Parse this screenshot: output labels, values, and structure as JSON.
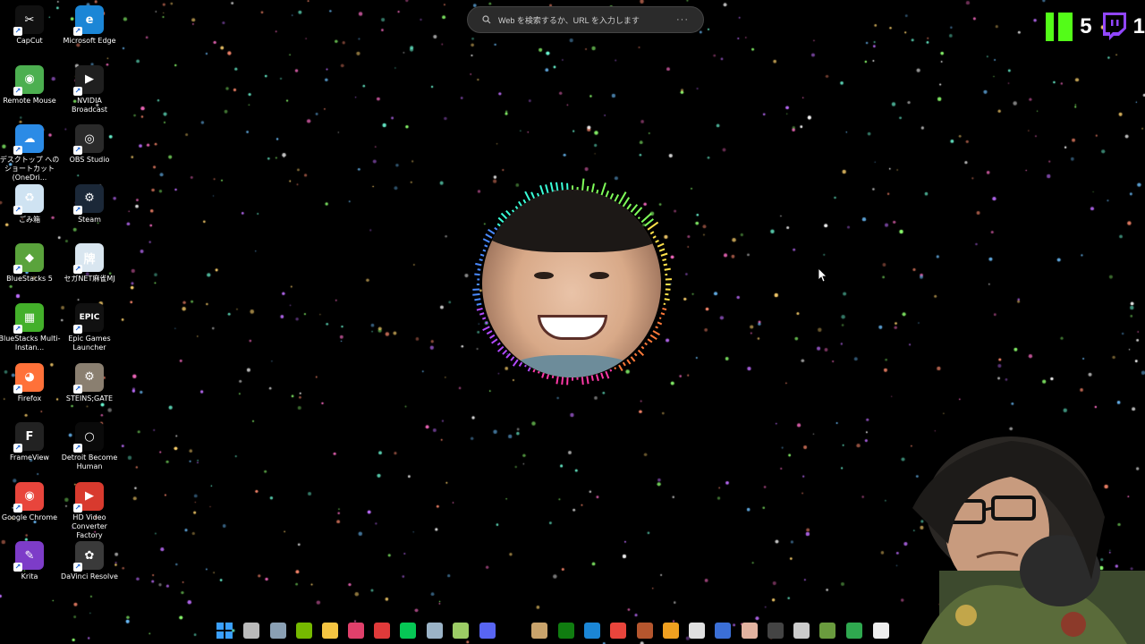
{
  "search": {
    "placeholder": "Web を検索するか、URL を入力します",
    "more": "···"
  },
  "overlay": {
    "kick_count": "5",
    "twitch_count": "1"
  },
  "desktop_icons": [
    {
      "id": "capcut",
      "label": "CapCut",
      "color": "#111111",
      "glyph": "✂",
      "col": 0,
      "row": 0
    },
    {
      "id": "edge",
      "label": "Microsoft Edge",
      "color": "#1b86d6",
      "glyph": "e",
      "col": 1,
      "row": 0
    },
    {
      "id": "remote-mouse",
      "label": "Remote Mouse",
      "color": "#4caf50",
      "glyph": "◉",
      "col": 0,
      "row": 1
    },
    {
      "id": "nvidia-broadcast",
      "label": "NVIDIA Broadcast",
      "color": "#1f1f1f",
      "glyph": "▶",
      "col": 1,
      "row": 1
    },
    {
      "id": "onedrive-shortcut",
      "label": "デスクトップ へのショートカット (OneDri...",
      "color": "#2b8be6",
      "glyph": "☁",
      "col": 0,
      "row": 2
    },
    {
      "id": "obs",
      "label": "OBS Studio",
      "color": "#2a2a2a",
      "glyph": "◎",
      "col": 1,
      "row": 2
    },
    {
      "id": "recycle-bin",
      "label": "ごみ箱",
      "color": "#cfe3f2",
      "glyph": "♻",
      "col": 0,
      "row": 3
    },
    {
      "id": "steam",
      "label": "Steam",
      "color": "#1b2838",
      "glyph": "⚙",
      "col": 1,
      "row": 3
    },
    {
      "id": "bluestacks5",
      "label": "BlueStacks 5",
      "color": "#5aa33c",
      "glyph": "◆",
      "col": 0,
      "row": 4
    },
    {
      "id": "sega-mj",
      "label": "セガNET麻雀MJ",
      "color": "#d9e6f0",
      "glyph": "牌",
      "col": 1,
      "row": 4
    },
    {
      "id": "bluestacks-multi",
      "label": "BlueStacks Multi-Instan...",
      "color": "#43b02a",
      "glyph": "▦",
      "col": 0,
      "row": 5
    },
    {
      "id": "epic",
      "label": "Epic Games Launcher",
      "color": "#111111",
      "glyph": "EPIC",
      "col": 1,
      "row": 5
    },
    {
      "id": "firefox",
      "label": "Firefox",
      "color": "#ff7139",
      "glyph": "◕",
      "col": 0,
      "row": 6
    },
    {
      "id": "steins-gate",
      "label": "STEINS;GATE",
      "color": "#8a7f70",
      "glyph": "⚙",
      "col": 1,
      "row": 6
    },
    {
      "id": "frameview",
      "label": "FrameView",
      "color": "#222222",
      "glyph": "F",
      "col": 0,
      "row": 7
    },
    {
      "id": "detroit",
      "label": "Detroit Become Human",
      "color": "#0a0a0a",
      "glyph": "○",
      "col": 1,
      "row": 7
    },
    {
      "id": "chrome",
      "label": "Google Chrome",
      "color": "#e8453c",
      "glyph": "◉",
      "col": 0,
      "row": 8
    },
    {
      "id": "hd-video",
      "label": "HD Video Converter Factory",
      "color": "#d83a2e",
      "glyph": "▶",
      "col": 1,
      "row": 8
    },
    {
      "id": "krita",
      "label": "Krita",
      "color": "#7d3cc8",
      "glyph": "✎",
      "col": 0,
      "row": 9
    },
    {
      "id": "davinci",
      "label": "DaVinci Resolve",
      "color": "#3a3a3a",
      "glyph": "✿",
      "col": 1,
      "row": 9
    }
  ],
  "taskbar_icons": [
    {
      "id": "start",
      "color": "#2d8fe6"
    },
    {
      "id": "task-view",
      "color": "#bbbbbb"
    },
    {
      "id": "steam-tb",
      "color": "#8aa0b4"
    },
    {
      "id": "nvidia-tb",
      "color": "#76b900"
    },
    {
      "id": "explorer",
      "color": "#f5c542"
    },
    {
      "id": "lips",
      "color": "#e0406b"
    },
    {
      "id": "record",
      "color": "#e03a3a"
    },
    {
      "id": "line",
      "color": "#06c755"
    },
    {
      "id": "network",
      "color": "#9bb3c7"
    },
    {
      "id": "v-app",
      "color": "#9ccc65"
    },
    {
      "id": "discord",
      "color": "#5865f2"
    },
    {
      "id": "app-a",
      "color": "#c9a36b"
    },
    {
      "id": "xbox",
      "color": "#107c10"
    },
    {
      "id": "edge-tb",
      "color": "#1b86d6"
    },
    {
      "id": "chrome-tb",
      "color": "#e8453c"
    },
    {
      "id": "app-b",
      "color": "#b5562e"
    },
    {
      "id": "app-c",
      "color": "#f0a020"
    },
    {
      "id": "app-d",
      "color": "#e0e0e0"
    },
    {
      "id": "app-e",
      "color": "#3b6fd6"
    },
    {
      "id": "app-f",
      "color": "#e3b3a0"
    },
    {
      "id": "app-g",
      "color": "#444444"
    },
    {
      "id": "app-h",
      "color": "#cccccc"
    },
    {
      "id": "minecraft",
      "color": "#6a9b3e"
    },
    {
      "id": "app-i",
      "color": "#2fa84f"
    },
    {
      "id": "capcut-tb",
      "color": "#eeeeee"
    }
  ]
}
